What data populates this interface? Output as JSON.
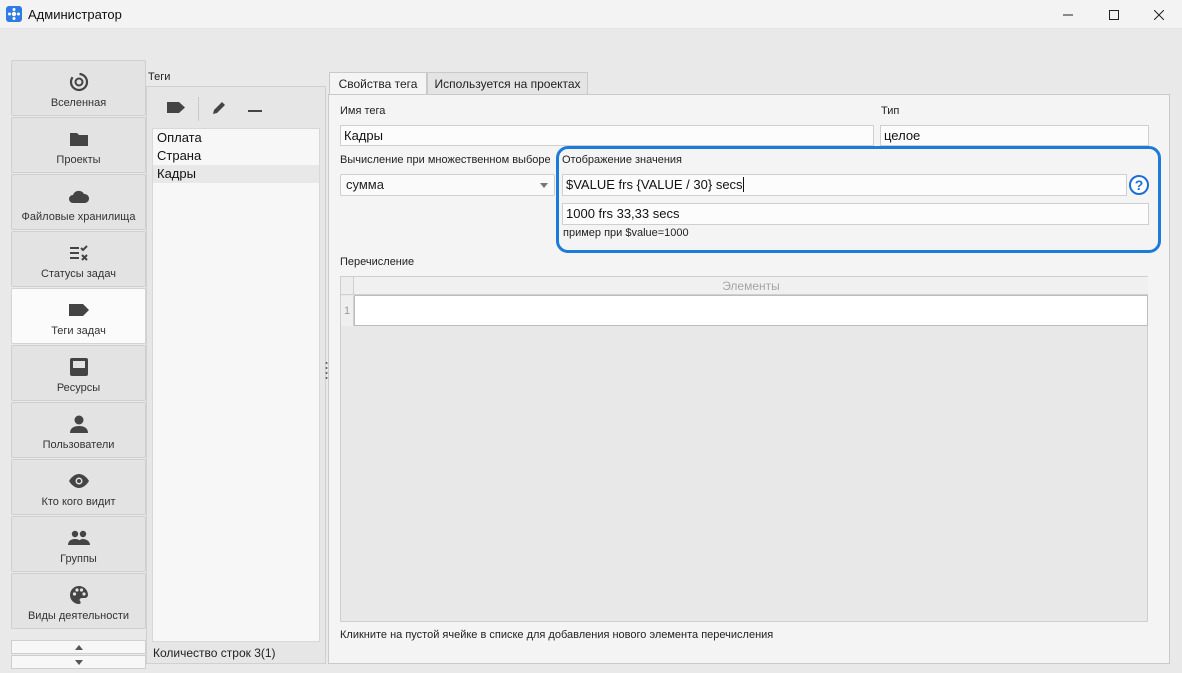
{
  "window": {
    "title": "Администратор"
  },
  "nav": {
    "items": [
      {
        "label": "Вселенная",
        "icon": "spiral-icon"
      },
      {
        "label": "Проекты",
        "icon": "folder-icon"
      },
      {
        "label": "Файловые хранилища",
        "icon": "cloud-icon"
      },
      {
        "label": "Статусы задач",
        "icon": "status-list-icon"
      },
      {
        "label": "Теги задач",
        "icon": "tag-icon",
        "active": true
      },
      {
        "label": "Ресурсы",
        "icon": "inbox-icon"
      },
      {
        "label": "Пользователи",
        "icon": "person-icon"
      },
      {
        "label": "Кто кого видит",
        "icon": "eye-icon"
      },
      {
        "label": "Группы",
        "icon": "group-icon"
      },
      {
        "label": "Виды деятельности",
        "icon": "palette-icon"
      }
    ]
  },
  "tags": {
    "heading": "Теги",
    "items": [
      "Оплата",
      "Страна",
      "Кадры"
    ],
    "selected_index": 2,
    "count_text": "Количество строк 3(1)"
  },
  "tabs": [
    {
      "label": "Свойства тега",
      "active": true
    },
    {
      "label": "Используется на проектах",
      "active": false
    }
  ],
  "form": {
    "tag_name_label": "Имя тега",
    "tag_name_value": "Кадры",
    "type_label": "Тип",
    "type_value": "целое",
    "aggregation_label": "Вычисление при множественном выборе",
    "aggregation_value": "сумма",
    "display_label": "Отображение значения",
    "display_value": "$VALUE frs {VALUE / 30} secs",
    "preview_value": "1000 frs 33,33 secs",
    "preview_hint": "пример при $value=1000",
    "help_symbol": "?",
    "enum_label": "Перечисление",
    "enum_table": {
      "column": "Элементы",
      "row_numbers": [
        "1"
      ]
    },
    "enum_hint": "Кликните на пустой ячейке в списке для добавления нового элемента перечисления"
  },
  "colors": {
    "highlight": "#1c7ad8",
    "accent": "#2f7ae5"
  }
}
